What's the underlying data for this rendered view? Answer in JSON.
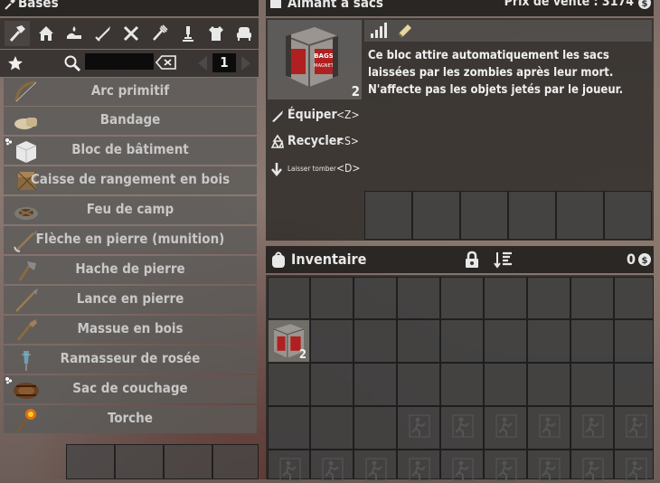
{
  "crafting": {
    "title": "Bases",
    "categories": [
      "hammer-icon",
      "house-icon",
      "hand-water-icon",
      "sword-icon",
      "wrench-icon",
      "fork-icon",
      "microscope-icon",
      "shirt-icon",
      "chair-icon"
    ],
    "search_placeholder": "",
    "page": "1",
    "recipes": [
      {
        "label": "Arc primitif",
        "icon": "bow-icon",
        "new": false
      },
      {
        "label": "Bandage",
        "icon": "bandage-icon",
        "new": false
      },
      {
        "label": "Bloc de bâtiment",
        "icon": "cube-icon",
        "new": true
      },
      {
        "label": "Caisse de rangement en bois",
        "icon": "crate-icon",
        "new": false
      },
      {
        "label": "Feu de camp",
        "icon": "campfire-icon",
        "new": false
      },
      {
        "label": "Flèche en pierre (munition)",
        "icon": "arrow-icon",
        "new": false
      },
      {
        "label": "Hache de pierre",
        "icon": "axe-icon",
        "new": false
      },
      {
        "label": "Lance en pierre",
        "icon": "spear-icon",
        "new": false
      },
      {
        "label": "Massue en bois",
        "icon": "club-icon",
        "new": false
      },
      {
        "label": "Ramasseur de rosée",
        "icon": "dew-collector-icon",
        "new": false
      },
      {
        "label": "Sac de couchage",
        "icon": "bedroll-icon",
        "new": true
      },
      {
        "label": "Torche",
        "icon": "torch-icon",
        "new": false
      }
    ]
  },
  "item": {
    "title": "Aimant à sacs",
    "sell_price": "Prix de vente : 3174",
    "count": "2",
    "description": "Ce bloc attire automatiquement les sacs laissées par les zombies après leur mort. N'affecte pas les objets jetés par le joueur.",
    "actions": [
      {
        "label": "Équiper",
        "key": "<Z>",
        "icon": "equip-icon"
      },
      {
        "label": "Recycler",
        "key": "<S>",
        "icon": "recycle-icon"
      },
      {
        "label": "Laisser tomber",
        "key": "<D>",
        "icon": "drop-icon"
      }
    ]
  },
  "inventory": {
    "title": "Inventaire",
    "coins": "0",
    "slot_item_count": "2"
  },
  "colors": {
    "accent": "#e8e8e8",
    "panel": "#2a2725",
    "slot": "#5c5a58",
    "crate_red": "#b02020"
  }
}
